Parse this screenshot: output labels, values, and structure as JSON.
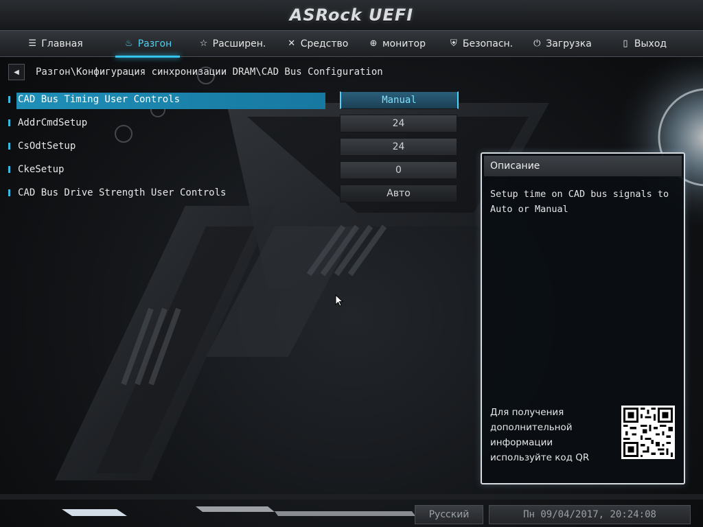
{
  "title_bar": {
    "logo": "ASRock UEFI"
  },
  "menu": {
    "tabs": [
      {
        "label": "Главная",
        "icon": "list-icon",
        "active": false
      },
      {
        "label": "Разгон",
        "icon": "flame-icon",
        "active": true
      },
      {
        "label": "Расширен.",
        "icon": "star-icon",
        "active": false
      },
      {
        "label": "Средство",
        "icon": "tools-icon",
        "active": false
      },
      {
        "label": "монитор",
        "icon": "crosshair-icon",
        "active": false
      },
      {
        "label": "Безопасн.",
        "icon": "shield-icon",
        "active": false
      },
      {
        "label": "Загрузка",
        "icon": "power-icon",
        "active": false
      },
      {
        "label": "Выход",
        "icon": "exit-door-icon",
        "active": false
      }
    ],
    "active_color": "#35c4ee"
  },
  "breadcrumb": {
    "back_icon": "back-arrow-icon",
    "path": "Разгон\\Конфигурация синхронизации DRAM\\CAD Bus Configuration"
  },
  "settings": [
    {
      "label": "CAD Bus Timing User Controls",
      "value": "Manual",
      "selected": true
    },
    {
      "label": "AddrCmdSetup",
      "value": "24",
      "selected": false
    },
    {
      "label": "CsOdtSetup",
      "value": "24",
      "selected": false
    },
    {
      "label": "CkeSetup",
      "value": "0",
      "selected": false
    },
    {
      "label": "CAD Bus Drive Strength User Controls",
      "value": "Авто",
      "selected": false
    }
  ],
  "description": {
    "header": "Описание",
    "text": "Setup time on CAD bus signals to Auto or Manual",
    "qr_text": "Для получения дополнительной информации используйте код QR"
  },
  "footer": {
    "language": "Русский",
    "datetime": "Пн 09/04/2017, 20:24:08"
  },
  "colors": {
    "accent": "#35c4ee",
    "selected_row": "#1f8fb8",
    "background": "#0c0d0f"
  }
}
